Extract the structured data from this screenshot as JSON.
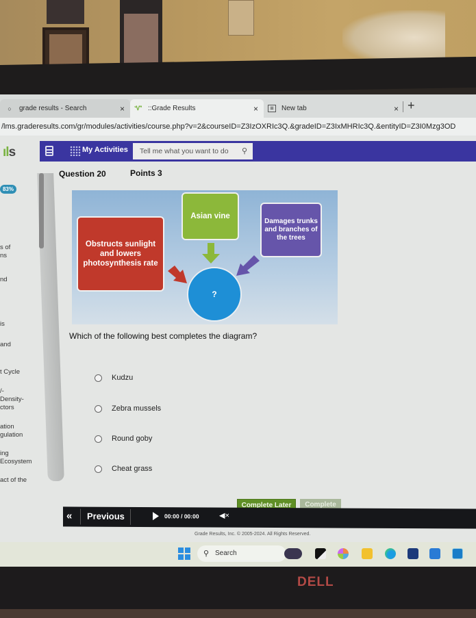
{
  "browser": {
    "tabs": [
      {
        "label": "grade results - Search",
        "icon": "search-icon",
        "active": false
      },
      {
        "label": "::Grade Results",
        "icon": "site-logo-icon",
        "active": true
      },
      {
        "label": "New tab",
        "icon": "new-tab-page-icon",
        "active": false
      }
    ],
    "close_glyph": "×",
    "new_tab_glyph": "+",
    "url": "/lms.graderesults.com/gr/modules/activities/course.php?v=2&courseID=Z3IzOXRIc3Q.&gradeID=Z3IxMHRIc3Q.&entityID=Z3I0Mzg3OD"
  },
  "app": {
    "logo_text": "ults",
    "nav": {
      "my_activities_label": "My Activities",
      "search_placeholder": "Tell me what you want to do"
    },
    "question": {
      "number_label": "Question 20",
      "points_label": "Points 3"
    }
  },
  "sidebar": {
    "progress": "83%",
    "items": [
      "s of",
      "ns",
      "nd",
      "is",
      "and",
      "t Cycle",
      "/-",
      "Density-",
      "ctors",
      "ation",
      "gulation",
      "ing",
      "Ecosystem",
      "act of the"
    ]
  },
  "diagram": {
    "effect_left": "Obstructs sunlight and lowers photosynthesis rate",
    "description_top": "Asian vine",
    "effect_right": "Damages trunks and branches of the trees",
    "center": "?",
    "colors": {
      "red": "#c0392b",
      "green": "#8cb83a",
      "purple": "#6655aa",
      "blue": "#1e8fd6"
    }
  },
  "prompt": "Which of the following best completes the diagram?",
  "options": [
    {
      "label": "Kudzu",
      "selected": false
    },
    {
      "label": "Zebra mussels",
      "selected": false
    },
    {
      "label": "Round goby",
      "selected": false
    },
    {
      "label": "Cheat grass",
      "selected": false
    }
  ],
  "actions": {
    "complete_later": "Complete Later",
    "complete": "Complete"
  },
  "player": {
    "back_glyph": "«",
    "previous_label": "Previous",
    "time": "00:00 / 00:00"
  },
  "footer": {
    "copyright": "Grade Results, Inc. © 2005-2024. All Rights Reserved."
  },
  "taskbar": {
    "search_label": "Search"
  },
  "device": {
    "brand": "DELL"
  }
}
